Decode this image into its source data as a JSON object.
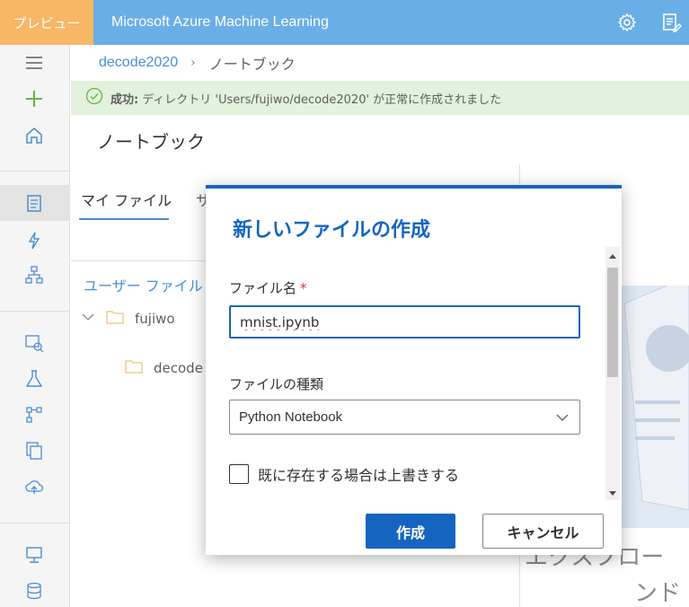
{
  "header": {
    "preview_label": "プレビュー",
    "app_title": "Microsoft Azure Machine Learning",
    "icons": [
      "gear-icon",
      "feedback-icon"
    ]
  },
  "nav": {
    "icons": [
      "hamburger-icon",
      "plus-icon",
      "home-icon",
      "notebook-icon",
      "automl-icon",
      "designer-icon",
      "datasets-icon",
      "experiments-icon",
      "pipelines-icon",
      "models-icon",
      "endpoints-icon",
      "compute-icon",
      "datastores-icon"
    ],
    "selected": "notebook-icon"
  },
  "breadcrumb": {
    "root": "decode2020",
    "current": "ノートブック"
  },
  "banner": {
    "status": "成功:",
    "message": "ディレクトリ 'Users/fujiwo/decode2020' が正常に作成されました"
  },
  "page": {
    "title": "ノートブック"
  },
  "files_panel": {
    "tab_mine": "マイ ファイル",
    "tab_other": "サ",
    "user_files": "ユーザー ファイル",
    "tree": [
      "fujiwo",
      "decode"
    ]
  },
  "background": {
    "text1": "エクスプロー",
    "text2": "ンド"
  },
  "dialog": {
    "title": "新しいファイルの作成",
    "filename_label": "ファイル名",
    "required_mark": "*",
    "filename_value": "mnist.ipynb",
    "filetype_label": "ファイルの種類",
    "filetype_value": "Python Notebook",
    "overwrite_label": "既に存在する場合は上書きする",
    "overwrite_checked": false,
    "create_button": "作成",
    "cancel_button": "キャンセル"
  },
  "colors": {
    "header": "#6aaee8",
    "preview": "#f8b765",
    "primary": "#1565c0",
    "banner": "#e2f2dc",
    "success_icon": "#6bb345"
  }
}
